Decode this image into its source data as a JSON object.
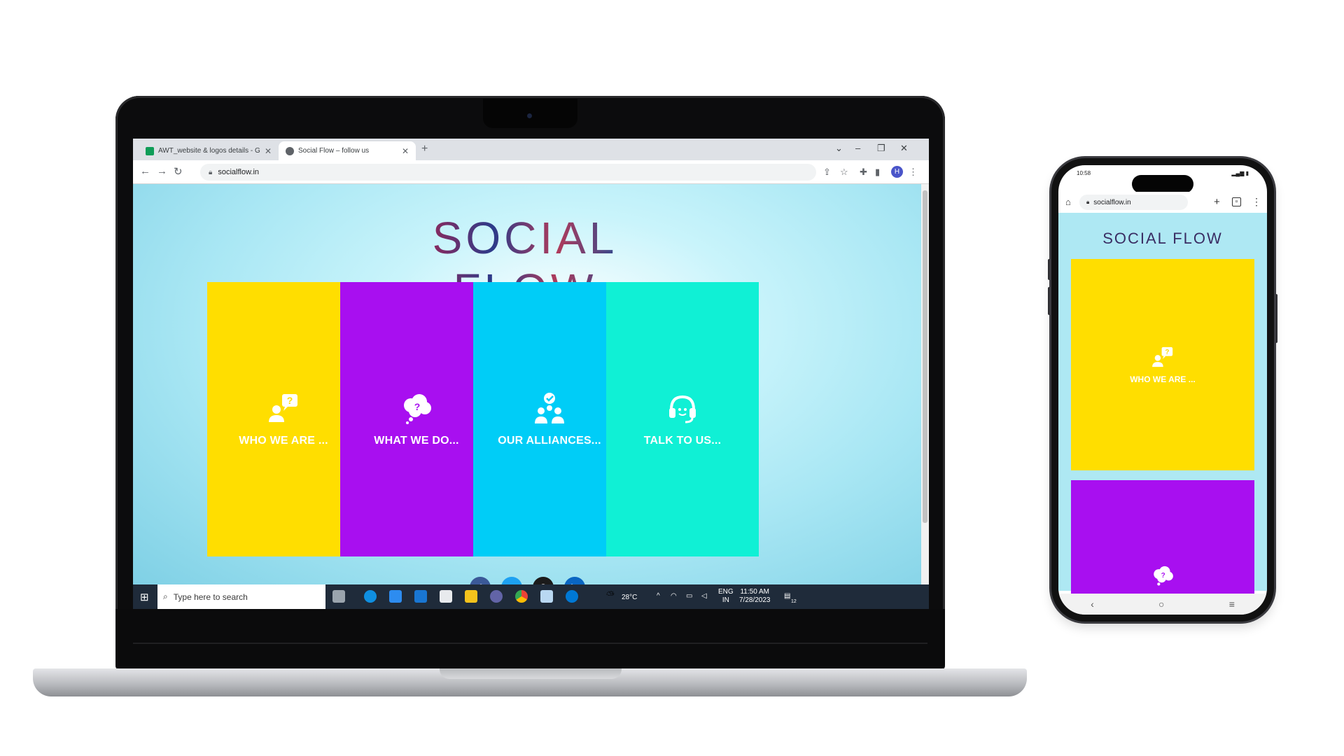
{
  "browser": {
    "tabs": [
      {
        "label": "AWT_website & logos details - G",
        "active": false
      },
      {
        "label": "Social Flow – follow us",
        "active": true
      }
    ],
    "url": "socialflow.in",
    "profile_initial": "H"
  },
  "site": {
    "logo": "SOCIAL FLOW",
    "cards": [
      {
        "label": "WHO WE ARE ...",
        "color": "#ffde00",
        "icon": "person-question-icon"
      },
      {
        "label": "WHAT WE DO...",
        "color": "#a80ff0",
        "icon": "thought-bubble-question-icon"
      },
      {
        "label": "OUR ALLIANCES...",
        "color": "#00cdf7",
        "icon": "team-check-icon"
      },
      {
        "label": "TALK TO US...",
        "color": "#10f0d5",
        "icon": "headset-icon"
      }
    ],
    "social_icons": [
      "facebook-icon",
      "twitter-icon",
      "instagram-icon",
      "linkedin-icon"
    ]
  },
  "taskbar": {
    "search_placeholder": "Type here to search",
    "weather": "28°C",
    "language_top": "ENG",
    "language_bottom": "IN",
    "time": "11:50 AM",
    "date": "7/28/2023",
    "notification_count": "12"
  },
  "phone": {
    "status_time": "10:58",
    "url": "socialflow.in",
    "logo": "SOCIAL FLOW",
    "card_label": "WHO WE ARE ..."
  }
}
